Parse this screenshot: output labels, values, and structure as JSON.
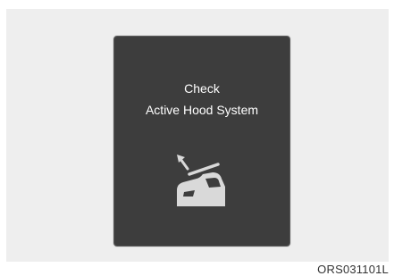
{
  "display": {
    "message_line1": "Check",
    "message_line2": "Active Hood System",
    "icon": "active-hood-icon"
  },
  "figure_code": "ORS031101L",
  "colors": {
    "screen": "#3d3d3d",
    "text": "#ffffff",
    "icon": "#d9d9d9",
    "background": "#eeeeee"
  }
}
